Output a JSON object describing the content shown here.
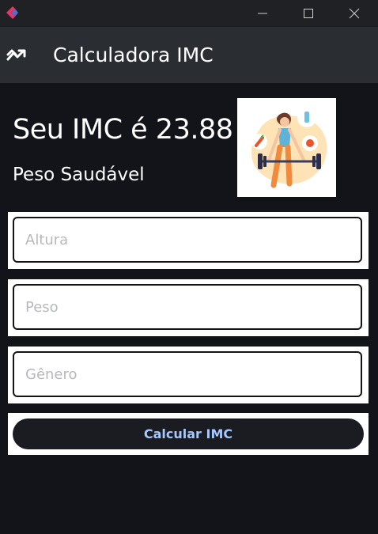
{
  "window": {
    "controls": [
      "minimize-icon",
      "maximize-icon",
      "close-icon"
    ]
  },
  "appbar": {
    "title": "Calculadora IMC",
    "icon": "trending-icon"
  },
  "result": {
    "bmi_text": "Seu IMC é 23.88",
    "status": "Peso Saudável"
  },
  "form": {
    "height_placeholder": "Altura",
    "weight_placeholder": "Peso",
    "gender_placeholder": "Gênero",
    "submit_label": "Calcular IMC"
  },
  "colors": {
    "background": "#121419",
    "appbar": "#2a2d31",
    "button_text": "#a8c7fa",
    "accent_logo": "#ff4081"
  }
}
